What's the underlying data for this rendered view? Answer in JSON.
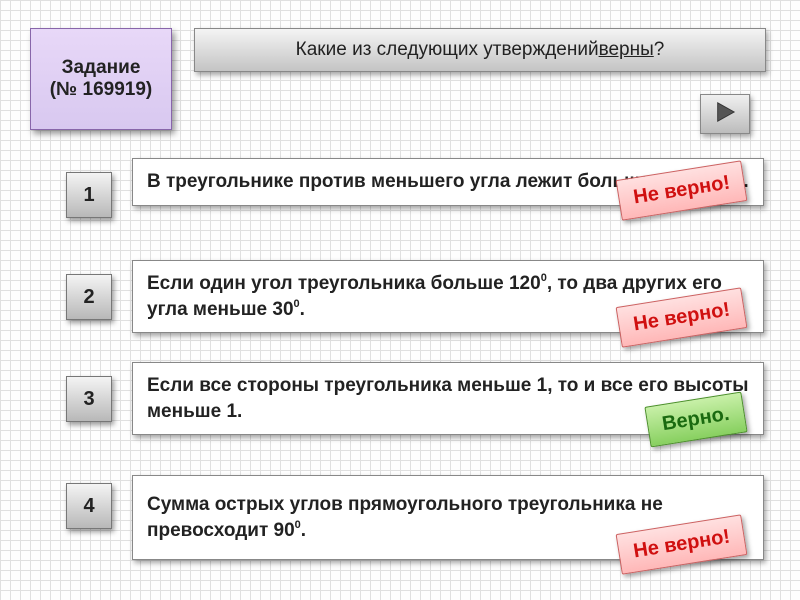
{
  "task": {
    "label": "Задание",
    "number": "(№ 169919)"
  },
  "question": {
    "prefix": "Какие из следующих утверждений ",
    "underline": "верны",
    "suffix": "?"
  },
  "stamps": {
    "wrong": "Не верно!",
    "right": "Верно."
  },
  "items": [
    {
      "num": "1",
      "text_html": "В треугольнике против меньшего угла лежит большая сторона.",
      "result": "wrong"
    },
    {
      "num": "2",
      "text_html": "Если один угол треугольника больше 120<span class=\"sup\">0</span>, то два других его угла меньше 30<span class=\"sup\">0</span>.",
      "result": "wrong"
    },
    {
      "num": "3",
      "text_html": "Если все стороны треугольника меньше 1, то и все его высоты меньше 1.",
      "result": "right"
    },
    {
      "num": "4",
      "text_html": "Сумма острых углов прямоугольного треугольника не превосходит 90<span class=\"sup\">0</span>.",
      "result": "wrong"
    }
  ]
}
